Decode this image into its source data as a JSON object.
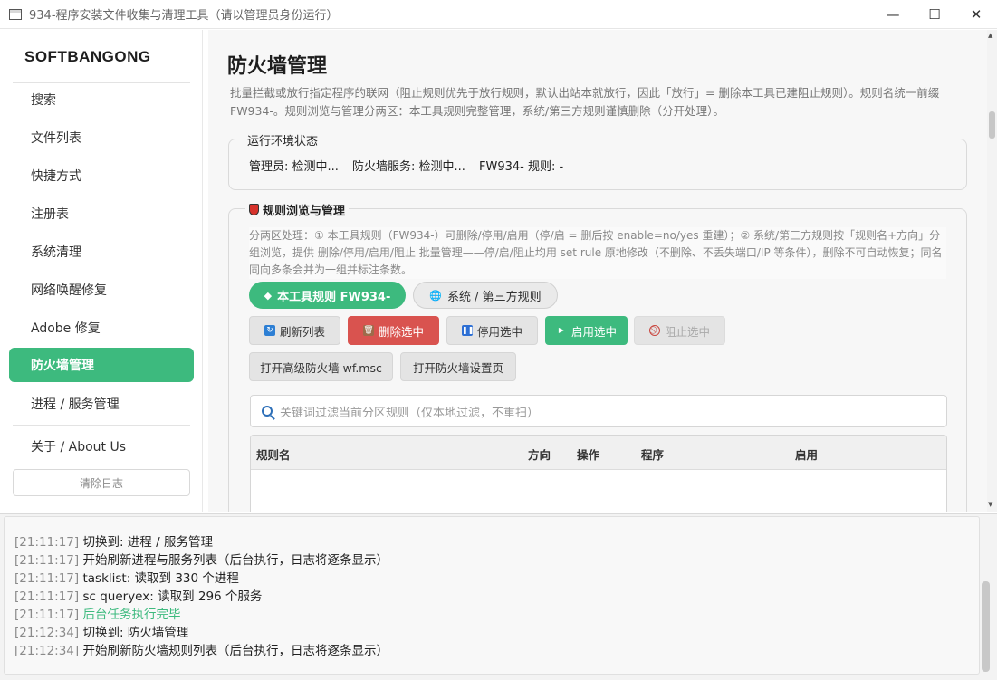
{
  "window": {
    "title": "934-程序安装文件收集与清理工具（请以管理员身份运行）",
    "minimize": "—",
    "maximize": "☐",
    "close": "✕"
  },
  "sidebar": {
    "brand": "SOFTBANGONG",
    "items": [
      {
        "label": "搜索"
      },
      {
        "label": "文件列表"
      },
      {
        "label": "快捷方式"
      },
      {
        "label": "注册表"
      },
      {
        "label": "系统清理"
      },
      {
        "label": "网络唤醒修复"
      },
      {
        "label": "Adobe 修复"
      },
      {
        "label": "防火墙管理",
        "active": true
      },
      {
        "label": "进程 / 服务管理"
      },
      {
        "label": "关于 / About Us"
      }
    ],
    "clear_log": "清除日志"
  },
  "main": {
    "title": "防火墙管理",
    "description": "批量拦截或放行指定程序的联网（阻止规则优先于放行规则，默认出站本就放行，因此「放行」= 删除本工具已建阻止规则）。规则名统一前缀 FW934-。规则浏览与管理分两区：本工具规则完整管理，系统/第三方规则谨慎删除（分开处理）。",
    "env": {
      "title": "运行环境状态",
      "admin": "管理员: 检测中...",
      "firewall_service": "防火墙服务: 检测中...",
      "rules": "FW934- 规则: -"
    },
    "rules_section": {
      "title": "规则浏览与管理",
      "note": "分两区处理：① 本工具规则（FW934-）可删除/停用/启用（停/启 = 删后按 enable=no/yes 重建）；② 系统/第三方规则按「规则名+方向」分组浏览，提供 删除/停用/启用/阻止 批量管理——停/启/阻止均用 set rule 原地修改（不删除、不丢失端口/IP 等条件），删除不可自动恢复；同名同向多条会并为一组并标注条数。",
      "tabs": {
        "own": "本工具规则 FW934-",
        "system": "系统 / 第三方规则"
      },
      "buttons": {
        "refresh": "刷新列表",
        "delete": "删除选中",
        "disable": "停用选中",
        "enable": "启用选中",
        "block": "阻止选中",
        "advanced": "打开高级防火墙 wf.msc",
        "settings": "打开防火墙设置页"
      },
      "filter_placeholder": "关键词过滤当前分区规则（仅本地过滤，不重扫）",
      "columns": [
        "规则名",
        "方向",
        "操作",
        "程序",
        "启用"
      ]
    }
  },
  "log": [
    {
      "time": "[21:11:17]",
      "text": "切换到: 进程 / 服务管理",
      "type": "normal"
    },
    {
      "time": "[21:11:17]",
      "text": "开始刷新进程与服务列表（后台执行，日志将逐条显示）",
      "type": "normal"
    },
    {
      "time": "[21:11:17]",
      "text": "tasklist: 读取到 330 个进程",
      "type": "normal"
    },
    {
      "time": "[21:11:17]",
      "text": "sc queryex: 读取到 296 个服务",
      "type": "normal"
    },
    {
      "time": "[21:11:17]",
      "text": "后台任务执行完毕",
      "type": "success"
    },
    {
      "time": "[21:12:34]",
      "text": "切换到: 防火墙管理",
      "type": "normal"
    },
    {
      "time": "[21:12:34]",
      "text": "开始刷新防火墙规则列表（后台执行，日志将逐条显示）",
      "type": "normal"
    }
  ],
  "colors": {
    "accent": "#3dba7e",
    "danger": "#d9534f",
    "log_success": "#3dba7e"
  }
}
